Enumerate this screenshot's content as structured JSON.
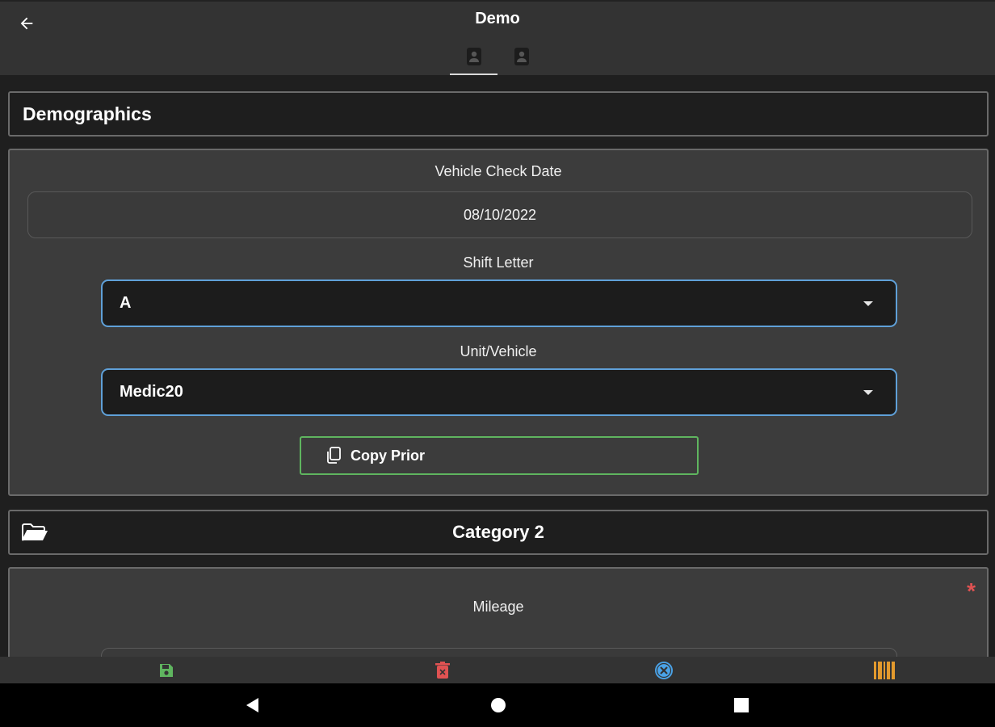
{
  "app": {
    "title": "Demo",
    "back_icon": "arrow-left-icon",
    "tabs": [
      {
        "icon": "contact-card-icon",
        "active": true
      },
      {
        "icon": "contact-card-icon",
        "active": false
      }
    ]
  },
  "demographics": {
    "header": "Demographics",
    "vehicle_check_date_label": "Vehicle Check Date",
    "vehicle_check_date_value": "08/10/2022",
    "shift_letter_label": "Shift Letter",
    "shift_letter_value": "A",
    "unit_vehicle_label": "Unit/Vehicle",
    "unit_vehicle_value": "Medic20",
    "copy_prior_label": "Copy Prior",
    "copy_prior_icon": "copy-icon"
  },
  "category2": {
    "header": "Category 2",
    "folder_icon": "folder-open-icon",
    "mileage_label": "Mileage",
    "required_mark": "*"
  },
  "toolbar": {
    "items": [
      {
        "icon": "save-icon",
        "color": "#5fb55f"
      },
      {
        "icon": "delete-icon",
        "color": "#e05252"
      },
      {
        "icon": "cancel-icon",
        "color": "#4aa3e8"
      },
      {
        "icon": "barcode-icon",
        "color": "#e39a2d"
      }
    ]
  },
  "system_nav": {
    "back_icon": "nav-back-icon",
    "home_icon": "nav-home-icon",
    "recents_icon": "nav-recents-icon"
  },
  "colors": {
    "accent_blue": "#5fa0d8",
    "accent_green": "#5fb55f",
    "required_red": "#e05252"
  }
}
